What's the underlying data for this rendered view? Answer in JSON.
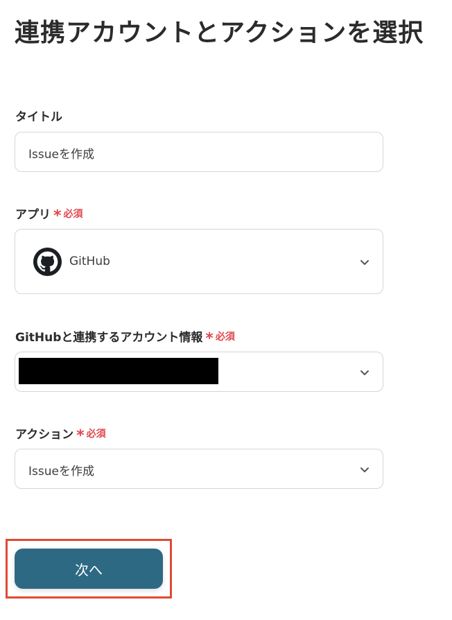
{
  "page": {
    "title": "連携アカウントとアクションを選択"
  },
  "fields": {
    "title": {
      "label": "タイトル",
      "value": "Issueを作成"
    },
    "app": {
      "label": "アプリ",
      "required_label": "必須",
      "selected_value": "GitHub",
      "icon": "github-icon"
    },
    "account": {
      "label": "GitHubと連携するアカウント情報",
      "required_label": "必須",
      "selected_value": ""
    },
    "action": {
      "label": "アクション",
      "required_label": "必須",
      "selected_value": "Issueを作成"
    }
  },
  "footer": {
    "next_button_label": "次へ"
  },
  "colors": {
    "primary_button": "#2e6983",
    "required": "#e0484e",
    "highlight_frame": "#e04a33",
    "border": "#d2d6da"
  }
}
